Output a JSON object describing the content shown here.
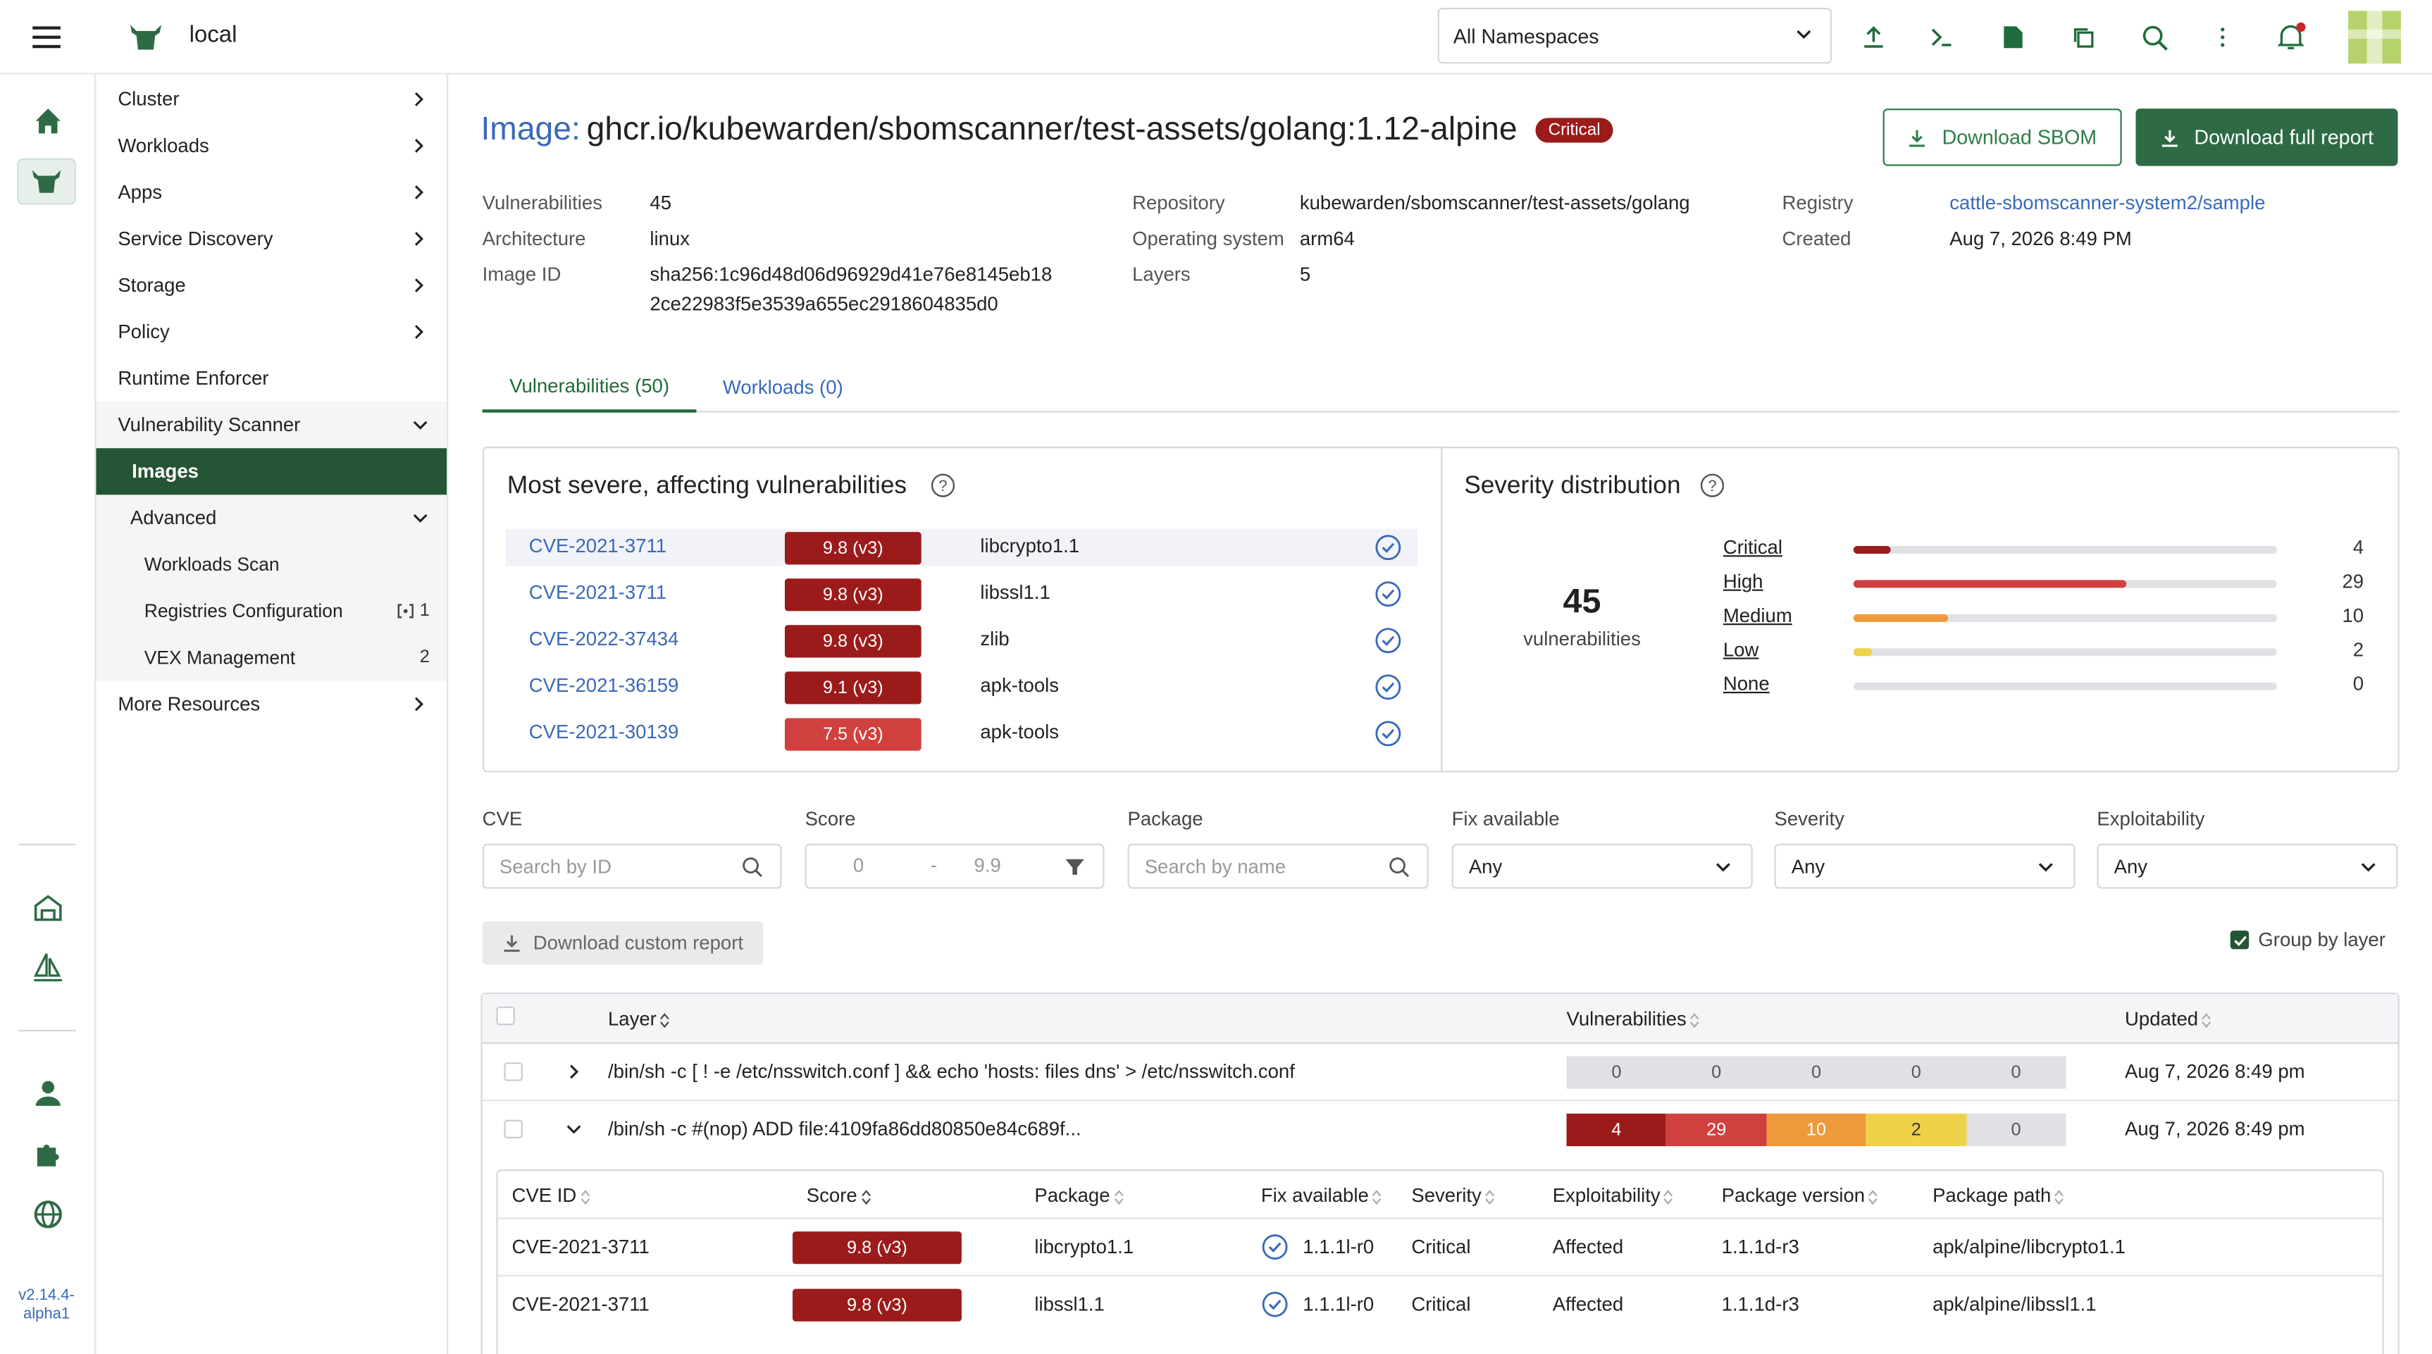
{
  "topbar": {
    "cluster_name": "local",
    "namespace": "All Namespaces"
  },
  "version": "v2.14.4-alpha1",
  "sidenav": {
    "items": [
      {
        "label": "Cluster"
      },
      {
        "label": "Workloads"
      },
      {
        "label": "Apps"
      },
      {
        "label": "Service Discovery"
      },
      {
        "label": "Storage"
      },
      {
        "label": "Policy"
      },
      {
        "label": "Runtime Enforcer"
      },
      {
        "label": "Vulnerability Scanner"
      },
      {
        "label": "Images"
      },
      {
        "label": "Advanced"
      },
      {
        "label": "Workloads Scan"
      },
      {
        "label": "Registries Configuration",
        "count": "1"
      },
      {
        "label": "VEX Management",
        "count": "2"
      },
      {
        "label": "More Resources"
      }
    ]
  },
  "header": {
    "prefix": "Image:",
    "name": "ghcr.io/kubewarden/sbomscanner/test-assets/golang:1.12-alpine",
    "severity": "Critical",
    "download_sbom": "Download SBOM",
    "download_full": "Download full report"
  },
  "meta": {
    "vulnerabilities_label": "Vulnerabilities",
    "vulnerabilities": "45",
    "architecture_label": "Architecture",
    "architecture": "linux",
    "image_id_label": "Image ID",
    "image_id_1": "sha256:1c96d48d06d96929d41e76e8145eb18",
    "image_id_2": "2ce22983f5e3539a655ec2918604835d0",
    "repository_label": "Repository",
    "repository": "kubewarden/sbomscanner/test-assets/golang",
    "os_label": "Operating system",
    "os": "arm64",
    "layers_label": "Layers",
    "layers": "5",
    "registry_label": "Registry",
    "registry": "cattle-sbomscanner-system2/sample",
    "created_label": "Created",
    "created": "Aug 7, 2026 8:49 PM"
  },
  "tabs": [
    {
      "label": "Vulnerabilities (50)"
    },
    {
      "label": "Workloads (0)"
    }
  ],
  "most_severe": {
    "title": "Most severe, affecting vulnerabilities",
    "rows": [
      {
        "id": "CVE-2021-3711",
        "score": "9.8 (v3)",
        "package": "libcrypto1.1"
      },
      {
        "id": "CVE-2021-3711",
        "score": "9.8 (v3)",
        "package": "libssl1.1"
      },
      {
        "id": "CVE-2022-37434",
        "score": "9.8 (v3)",
        "package": "zlib"
      },
      {
        "id": "CVE-2021-36159",
        "score": "9.1 (v3)",
        "package": "apk-tools"
      },
      {
        "id": "CVE-2021-30139",
        "score": "7.5 (v3)",
        "package": "apk-tools"
      }
    ]
  },
  "severity_distribution": {
    "title": "Severity distribution",
    "total": "45",
    "total_label": "vulnerabilities",
    "levels": [
      {
        "label": "Critical",
        "count": 4,
        "color": "#9b1b1b"
      },
      {
        "label": "High",
        "count": 29,
        "color": "#d0403f"
      },
      {
        "label": "Medium",
        "count": 10,
        "color": "#ef9a3a"
      },
      {
        "label": "Low",
        "count": 2,
        "color": "#f0d24a"
      },
      {
        "label": "None",
        "count": 0,
        "color": "#dfe1e5"
      }
    ]
  },
  "filters": {
    "cve_label": "CVE",
    "cve_placeholder": "Search by ID",
    "score_label": "Score",
    "score_min": "0",
    "score_sep": "-",
    "score_max": "9.9",
    "package_label": "Package",
    "package_placeholder": "Search by name",
    "fix_label": "Fix available",
    "fix_value": "Any",
    "severity_label": "Severity",
    "severity_value": "Any",
    "exploit_label": "Exploitability",
    "exploit_value": "Any"
  },
  "actions": {
    "download_custom": "Download custom report",
    "group_by_layer": "Group by layer"
  },
  "layers_table": {
    "headers": {
      "layer": "Layer",
      "vulnerabilities": "Vulnerabilities",
      "updated": "Updated"
    },
    "rows": [
      {
        "layer": "/bin/sh -c [ ! -e /etc/nsswitch.conf ] && echo 'hosts: files dns' > /etc/nsswitch.conf",
        "counts": [
          "0",
          "0",
          "0",
          "0",
          "0"
        ],
        "updated": "Aug 7, 2026 8:49 pm"
      },
      {
        "layer": "/bin/sh -c #(nop) ADD file:4109fa86dd80850e84c689f...",
        "counts": [
          "4",
          "29",
          "10",
          "2",
          "0"
        ],
        "updated": "Aug 7, 2026 8:49 pm"
      }
    ]
  },
  "cve_table": {
    "headers": {
      "id": "CVE ID",
      "score": "Score",
      "package": "Package",
      "fix": "Fix available",
      "severity": "Severity",
      "exploit": "Exploitability",
      "version": "Package version",
      "path": "Package path"
    },
    "rows": [
      {
        "id": "CVE-2021-3711",
        "score": "9.8 (v3)",
        "package": "libcrypto1.1",
        "fix": "1.1.1l-r0",
        "severity": "Critical",
        "exploit": "Affected",
        "version": "1.1.1d-r3",
        "path": "apk/alpine/libcrypto1.1"
      },
      {
        "id": "CVE-2021-3711",
        "score": "9.8 (v3)",
        "package": "libssl1.1",
        "fix": "1.1.1l-r0",
        "severity": "Critical",
        "exploit": "Affected",
        "version": "1.1.1d-r3",
        "path": "apk/alpine/libssl1.1"
      }
    ]
  }
}
